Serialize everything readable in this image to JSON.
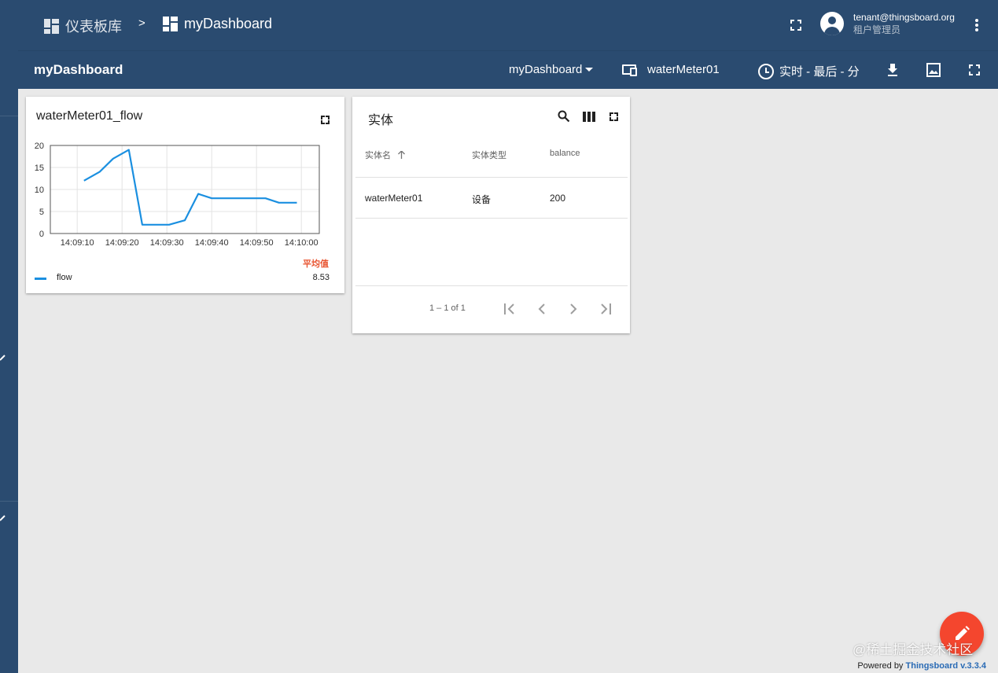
{
  "header": {
    "breadcrumb_root": "仪表板库",
    "breadcrumb_separator": ">",
    "breadcrumb_current": "myDashboard",
    "user_name": "tenant@thingsboard.org",
    "user_role": "租户管理员",
    "fullscreen_icon": "fullscreen-icon",
    "avatar_icon": "account-circle-icon",
    "menu_icon": "more-vert-icon"
  },
  "toolbar": {
    "dashboard_title": "myDashboard",
    "dashboard_select": "myDashboard",
    "entity_alias": "waterMeter01",
    "timewindow": "实时 - 最后 - 分",
    "icons": [
      "download-icon",
      "export-image-icon",
      "fullscreen-icon"
    ]
  },
  "chart_widget": {
    "title": "waterMeter01_flow",
    "avg_header": "平均值",
    "legend_label": "flow",
    "legend_avg_value": "8.53",
    "line_color": "#1a8fe0"
  },
  "chart_data": {
    "type": "line",
    "title": "waterMeter01_flow",
    "xlabel": "",
    "ylabel": "",
    "x_ticks": [
      "14:09:10",
      "14:09:20",
      "14:09:30",
      "14:09:40",
      "14:09:50",
      "14:10:00"
    ],
    "y_ticks": [
      "0",
      "5",
      "10",
      "15",
      "20"
    ],
    "ylim": [
      0,
      20
    ],
    "xlim_seconds_from_14_09_00": [
      4,
      64
    ],
    "grid": true,
    "series": [
      {
        "name": "flow",
        "x": [
          "14:09:11.5",
          "14:09:15",
          "14:09:18",
          "14:09:21.5",
          "14:09:24.5",
          "14:09:27.5",
          "14:09:30.5",
          "14:09:34",
          "14:09:37",
          "14:09:40",
          "14:09:44",
          "14:09:48",
          "14:09:52",
          "14:09:55",
          "14:09:59"
        ],
        "values": [
          12,
          14,
          17,
          19,
          2,
          2,
          2,
          3,
          9,
          8,
          8,
          8,
          8,
          7,
          7
        ]
      }
    ]
  },
  "table_widget": {
    "title": "实体",
    "columns": [
      "实体名",
      "实体类型",
      "balance"
    ],
    "rows": [
      [
        "waterMeter01",
        "设备",
        "200"
      ]
    ],
    "pagination": "1 – 1 of 1",
    "sort_icon": "arrow-up-icon"
  },
  "footer": {
    "watermark": "@稀土掘金技术社区",
    "powered_prefix": "Powered by",
    "powered_brand": "Thingsboard v.3.3.4"
  },
  "colors": {
    "primary": "#2a4b70",
    "accent": "#f4462e",
    "avg_header": "#e8532f",
    "background": "#e9e9e9"
  }
}
